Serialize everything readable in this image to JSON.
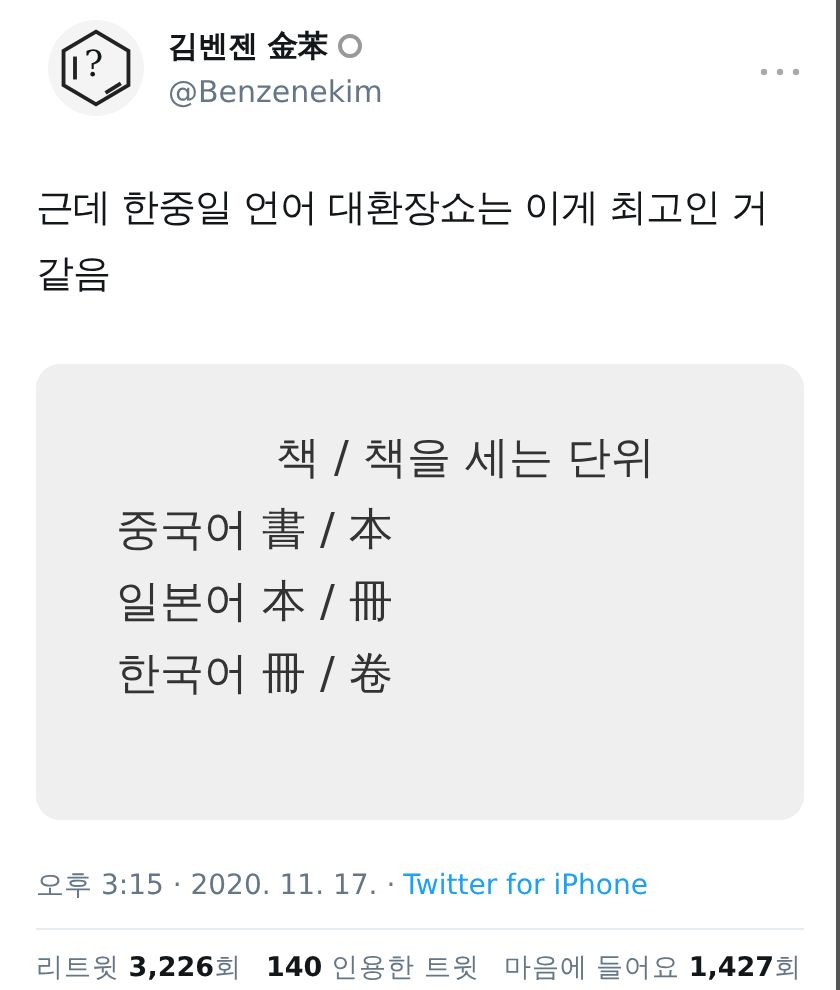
{
  "author": {
    "avatar_glyph": "?",
    "name": "김벤젠 金苯",
    "verified": true,
    "handle": "@Benzenekim"
  },
  "tweet_text": "근데 한중일 언어 대환장쇼는 이게 최고인 거 같음",
  "image": {
    "lines": [
      {
        "text": "책 / 책을 세는 단위",
        "kind": "heading"
      },
      {
        "text": "중국어 書 / 本",
        "kind": "row"
      },
      {
        "text": "일본어 本 / 冊",
        "kind": "row"
      },
      {
        "text": "한국어 冊 / 卷",
        "kind": "row"
      }
    ]
  },
  "meta": {
    "time": "오후 3:15 · 2020. 11. 17. ·",
    "source": "Twitter for iPhone"
  },
  "stats": [
    "리트윗 **3,226**회",
    "**140** 인용한 트윗",
    "마음에 들어요 **1,427**회"
  ]
}
